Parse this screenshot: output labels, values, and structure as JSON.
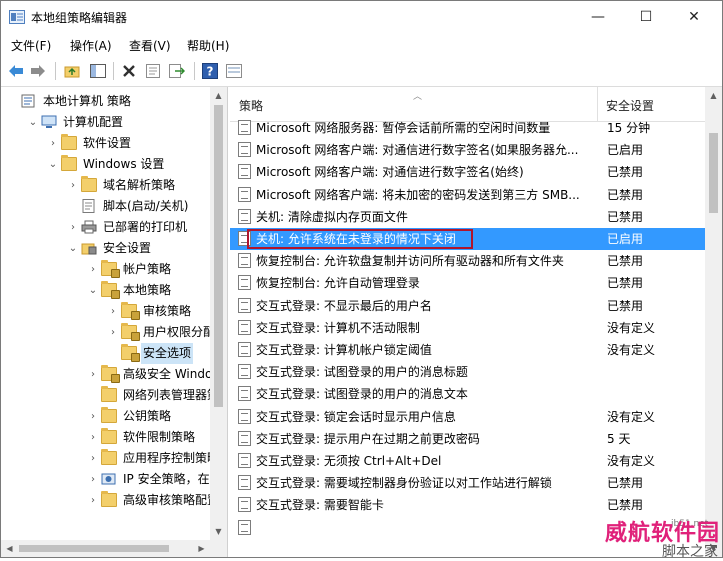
{
  "window": {
    "title": "本地组策略编辑器",
    "controls": {
      "minimize": "—",
      "maximize": "☐",
      "close": "✕"
    }
  },
  "menu": [
    "文件(F)",
    "操作(A)",
    "查看(V)",
    "帮助(H)"
  ],
  "toolbar": [
    "back-icon",
    "forward-icon",
    "up-folder-icon",
    "show-tree-icon",
    "delete-icon",
    "properties-icon",
    "export-icon",
    "help-icon",
    "filter-icon"
  ],
  "tree": [
    {
      "label": "本地计算机 策略",
      "level": 0,
      "arrow": "",
      "icon": "policy-root-icon"
    },
    {
      "label": "计算机配置",
      "level": 1,
      "arrow": "open",
      "icon": "computer-icon"
    },
    {
      "label": "软件设置",
      "level": 2,
      "arrow": "closed",
      "icon": "folder-icon"
    },
    {
      "label": "Windows 设置",
      "level": 2,
      "arrow": "open",
      "icon": "folder-icon"
    },
    {
      "label": "域名解析策略",
      "level": 3,
      "arrow": "closed",
      "icon": "folder-icon"
    },
    {
      "label": "脚本(启动/关机)",
      "level": 3,
      "arrow": "",
      "icon": "script-icon"
    },
    {
      "label": "已部署的打印机",
      "level": 3,
      "arrow": "closed",
      "icon": "printer-icon"
    },
    {
      "label": "安全设置",
      "level": 3,
      "arrow": "open",
      "icon": "security-icon"
    },
    {
      "label": "帐户策略",
      "level": 4,
      "arrow": "closed",
      "icon": "secure-folder-icon"
    },
    {
      "label": "本地策略",
      "level": 4,
      "arrow": "open",
      "icon": "secure-folder-icon"
    },
    {
      "label": "审核策略",
      "level": 5,
      "arrow": "closed",
      "icon": "secure-folder-icon"
    },
    {
      "label": "用户权限分配",
      "level": 5,
      "arrow": "closed",
      "icon": "secure-folder-icon"
    },
    {
      "label": "安全选项",
      "level": 5,
      "arrow": "",
      "icon": "secure-folder-icon",
      "selected": true
    },
    {
      "label": "高级安全 Window",
      "level": 4,
      "arrow": "closed",
      "icon": "secure-folder-icon"
    },
    {
      "label": "网络列表管理器策",
      "level": 4,
      "arrow": "",
      "icon": "folder-icon"
    },
    {
      "label": "公钥策略",
      "level": 4,
      "arrow": "closed",
      "icon": "folder-icon"
    },
    {
      "label": "软件限制策略",
      "level": 4,
      "arrow": "closed",
      "icon": "folder-icon"
    },
    {
      "label": "应用程序控制策略",
      "level": 4,
      "arrow": "closed",
      "icon": "folder-icon"
    },
    {
      "label": "IP 安全策略，在 :",
      "level": 4,
      "arrow": "closed",
      "icon": "ip-security-icon"
    },
    {
      "label": "高级审核策略配置",
      "level": 4,
      "arrow": "closed",
      "icon": "folder-icon"
    }
  ],
  "list": {
    "col_policy": "策略",
    "col_setting": "安全设置",
    "rows": [
      {
        "name": "Microsoft 网络服务器: 暂停会话前所需的空闲时间数量",
        "value": "15 分钟"
      },
      {
        "name": "Microsoft 网络客户端: 对通信进行数字签名(如果服务器允...",
        "value": "已启用"
      },
      {
        "name": "Microsoft 网络客户端: 对通信进行数字签名(始终)",
        "value": "已禁用"
      },
      {
        "name": "Microsoft 网络客户端: 将未加密的密码发送到第三方 SMB...",
        "value": "已禁用"
      },
      {
        "name": "关机: 清除虚拟内存页面文件",
        "value": "已禁用"
      },
      {
        "name": "关机: 允许系统在未登录的情况下关闭",
        "value": "已启用",
        "selected": true
      },
      {
        "name": "恢复控制台: 允许软盘复制并访问所有驱动器和所有文件夹",
        "value": "已禁用"
      },
      {
        "name": "恢复控制台: 允许自动管理登录",
        "value": "已禁用"
      },
      {
        "name": "交互式登录: 不显示最后的用户名",
        "value": "已禁用"
      },
      {
        "name": "交互式登录: 计算机不活动限制",
        "value": "没有定义"
      },
      {
        "name": "交互式登录: 计算机帐户锁定阈值",
        "value": "没有定义"
      },
      {
        "name": "交互式登录: 试图登录的用户的消息标题",
        "value": ""
      },
      {
        "name": "交互式登录: 试图登录的用户的消息文本",
        "value": ""
      },
      {
        "name": "交互式登录: 锁定会话时显示用户信息",
        "value": "没有定义"
      },
      {
        "name": "交互式登录: 提示用户在过期之前更改密码",
        "value": "5 天"
      },
      {
        "name": "交互式登录: 无须按 Ctrl+Alt+Del",
        "value": "没有定义"
      },
      {
        "name": "交互式登录: 需要域控制器身份验证以对工作站进行解锁",
        "value": "已禁用"
      },
      {
        "name": "交互式登录: 需要智能卡",
        "value": "已禁用"
      },
      {
        "name": "",
        "value": ""
      }
    ]
  },
  "watermark": {
    "main": "威航软件园",
    "sub": "脚本之家",
    "small": "jb51.net"
  },
  "colors": {
    "selection": "#3399ff",
    "tree_selection": "#cce4f7",
    "highlight_border": "#b0152d",
    "watermark": "#e0217a"
  }
}
